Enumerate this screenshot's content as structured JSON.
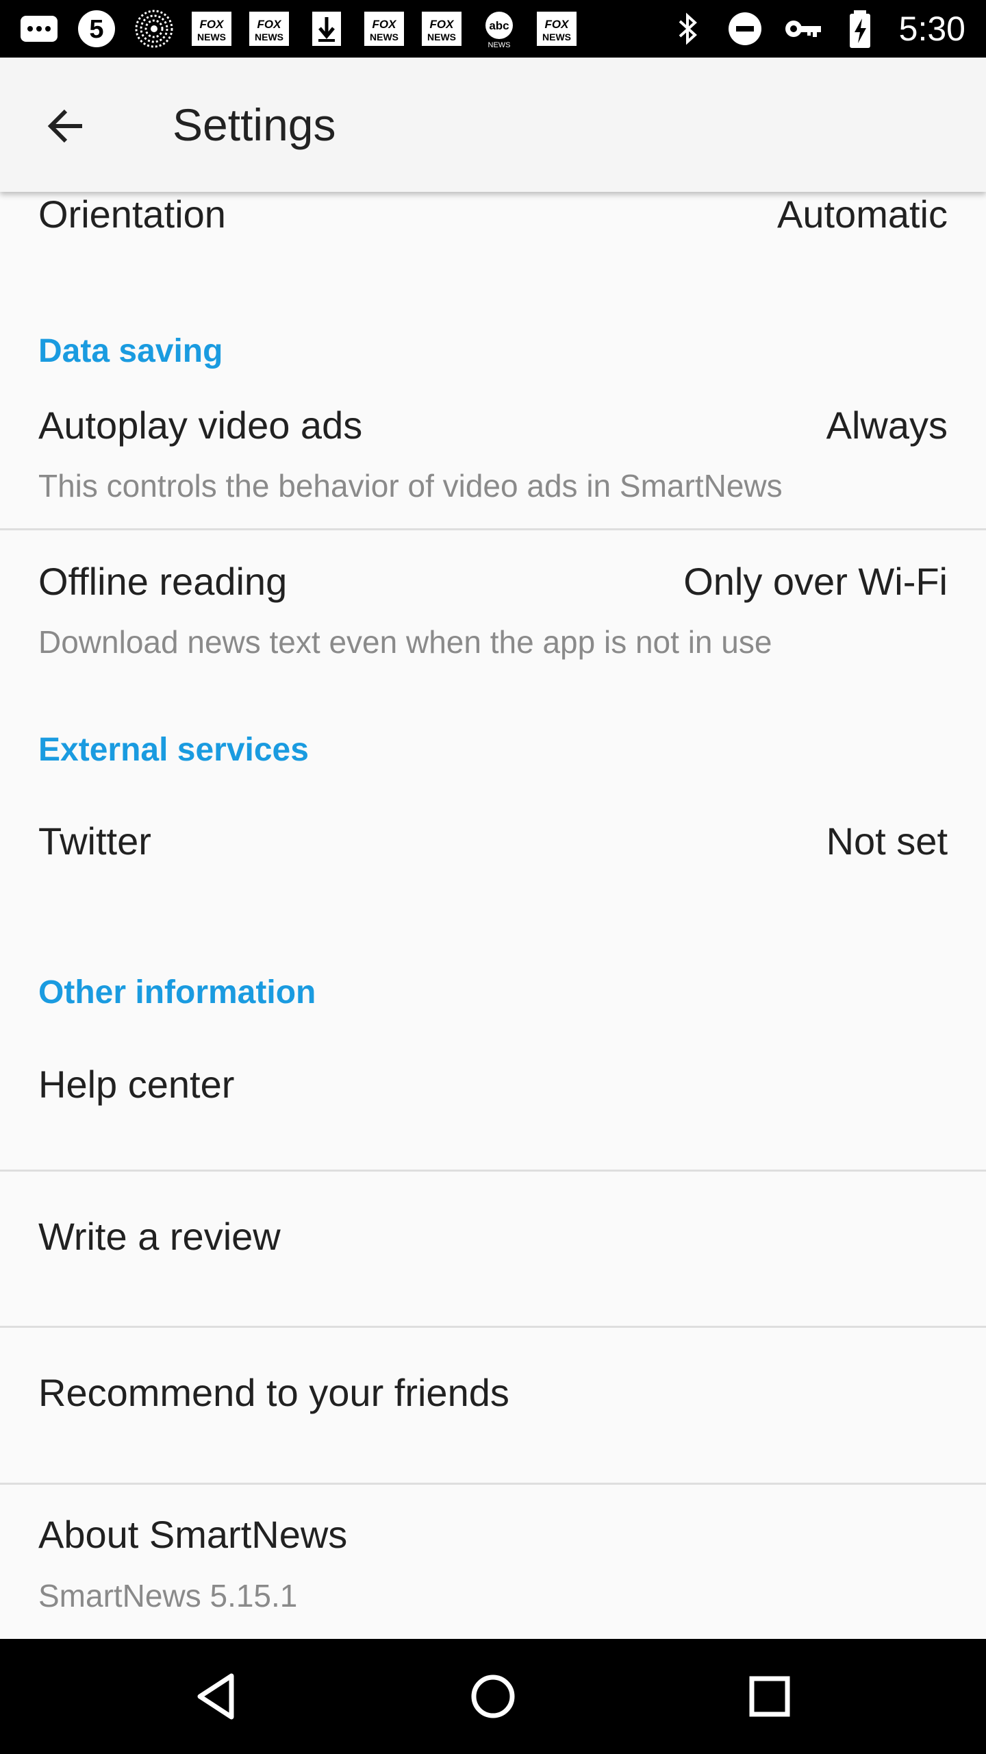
{
  "status_bar": {
    "time": "5:30",
    "icons_left": [
      "message-icon",
      "channel-5-icon",
      "radial-logo-icon",
      "fox-news-icon",
      "fox-news-icon",
      "download-icon",
      "fox-news-icon",
      "fox-news-icon",
      "abc-news-icon",
      "fox-news-icon"
    ],
    "icons_right": [
      "bluetooth-icon",
      "do-not-disturb-icon",
      "vpn-key-icon",
      "battery-charging-icon"
    ],
    "fox_label": "FOX NEWS",
    "abc_label": "abc",
    "five_label": "5"
  },
  "appbar": {
    "title": "Settings"
  },
  "settings": {
    "orientation": {
      "label": "Orientation",
      "value": "Automatic"
    },
    "data_saving_header": "Data saving",
    "autoplay": {
      "label": "Autoplay video ads",
      "value": "Always",
      "desc": "This controls the behavior of video ads in SmartNews"
    },
    "offline": {
      "label": "Offline reading",
      "value": "Only over Wi-Fi",
      "desc": "Download news text even when the app is not in use"
    },
    "external_header": "External services",
    "twitter": {
      "label": "Twitter",
      "value": "Not set"
    },
    "other_header": "Other information",
    "help": {
      "label": "Help center"
    },
    "review": {
      "label": "Write a review"
    },
    "recommend": {
      "label": "Recommend to your friends"
    },
    "about": {
      "label": "About SmartNews",
      "desc": "SmartNews 5.15.1"
    }
  },
  "colors": {
    "accent": "#1a9be0",
    "background": "#fafafa",
    "appbar": "#f5f5f5",
    "text": "#212121",
    "secondary": "#8a8a8a"
  }
}
